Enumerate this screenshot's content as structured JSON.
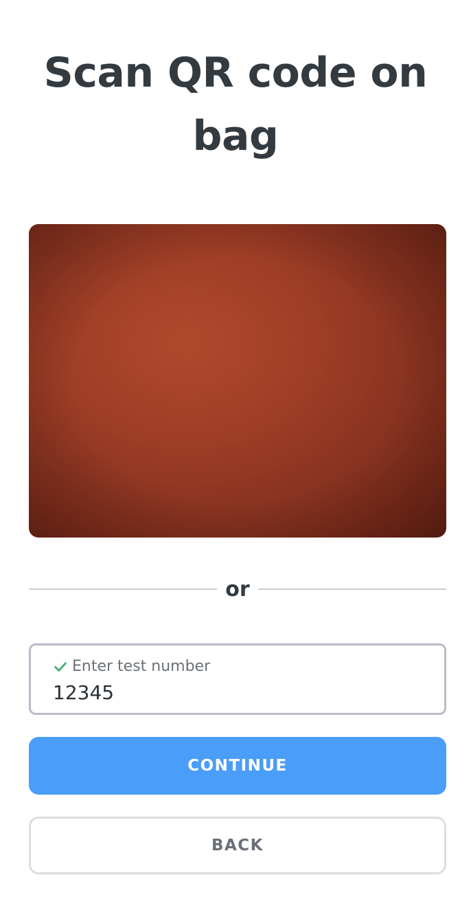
{
  "header": {
    "title": "Scan QR code on bag"
  },
  "scanner": {
    "divider_text": "or"
  },
  "test_number_field": {
    "label": "Enter test number",
    "value": "12345",
    "valid": true
  },
  "actions": {
    "continue_label": "CONTINUE",
    "back_label": "BACK"
  },
  "colors": {
    "primary": "#4a9df8",
    "heading": "#333a40",
    "check": "#4caf7a",
    "field_border": "#b9bcc6"
  }
}
